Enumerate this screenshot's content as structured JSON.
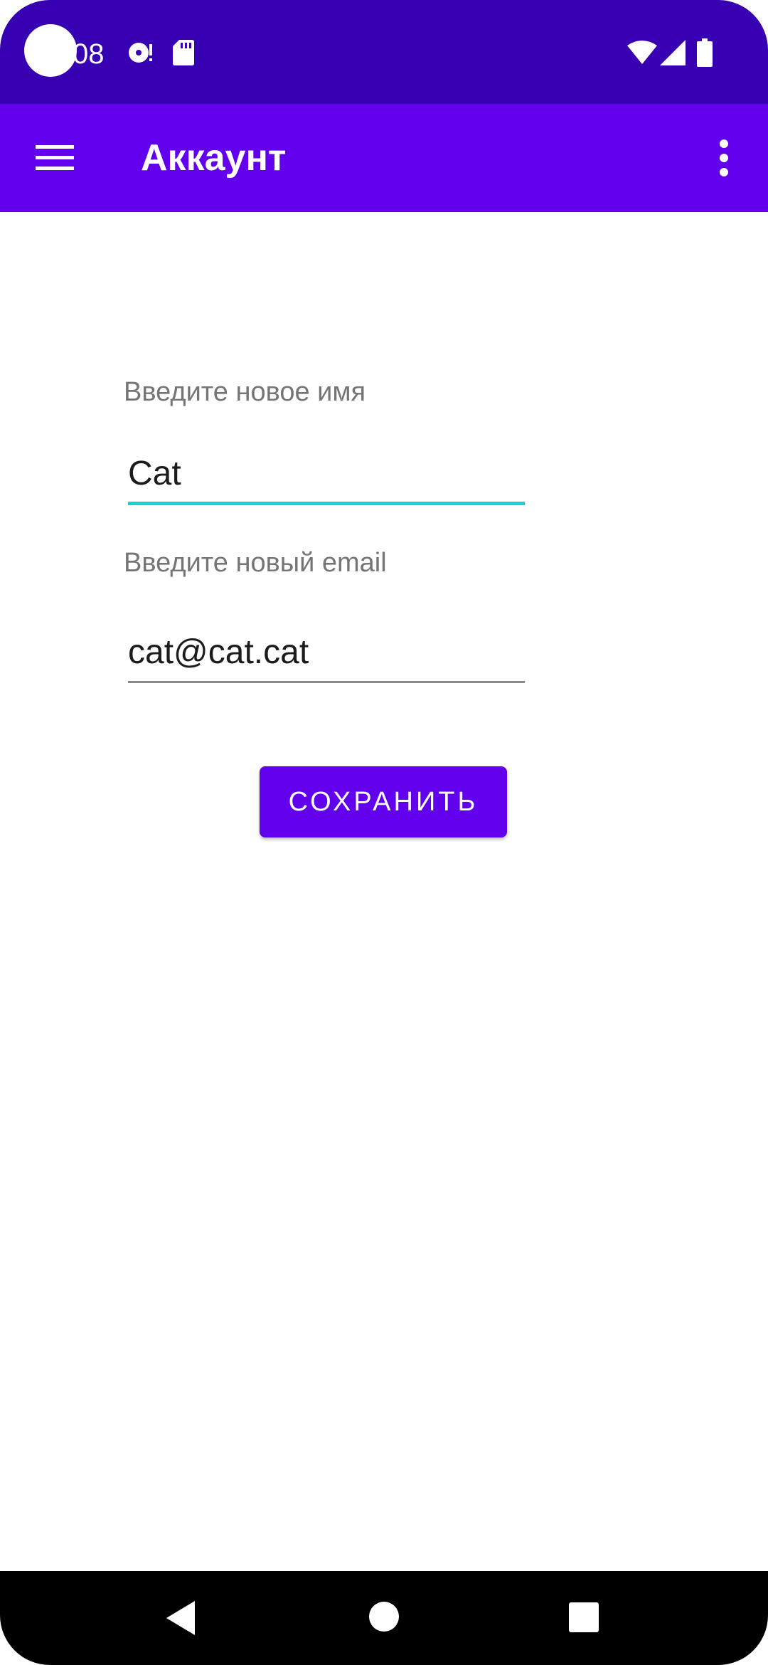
{
  "status_bar": {
    "time": "08",
    "icons": [
      "disc-notification-icon",
      "sd-card-icon",
      "wifi-icon",
      "cellular-signal-icon",
      "battery-icon"
    ]
  },
  "app_bar": {
    "title": "Аккаунт",
    "menu_icon": "hamburger-menu-icon",
    "overflow_icon": "more-vertical-icon",
    "color": "#6200EE"
  },
  "form": {
    "name_label": "Введите новое имя",
    "name_value": "Cat",
    "email_label": "Введите новый email",
    "email_value": "cat@cat.cat",
    "focused_underline_color": "#1ECFCA",
    "save_label": "СОХРАНИТЬ"
  },
  "nav_bar": {
    "icons": [
      "back-icon",
      "home-icon",
      "recents-icon"
    ]
  }
}
